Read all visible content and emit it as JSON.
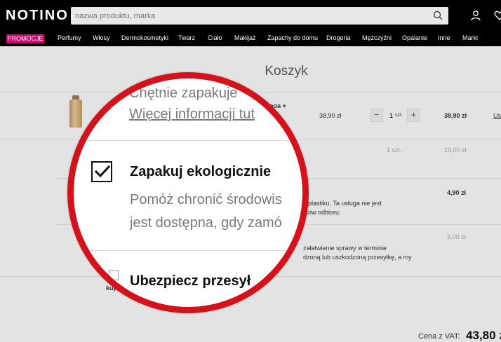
{
  "header": {
    "logo": "NOTINO",
    "search_placeholder": "nazwa produktu, marka",
    "icons": [
      "search-icon",
      "user-icon",
      "heart-icon"
    ]
  },
  "nav": {
    "promo": "PROMOCJE",
    "items": [
      "Perfumy",
      "Włosy",
      "Dermokosmetyki",
      "Twarz",
      "Ciało",
      "Makijaż",
      "Zapachy do domu",
      "Drogeria",
      "Mężczyźni",
      "Opalanie",
      "Inne",
      "Marki"
    ]
  },
  "cart": {
    "title": "Koszyk",
    "product": {
      "name_fragment": "noa +",
      "unit_price": "38,90 zł",
      "qty": "1",
      "qty_unit": "szt.",
      "total": "38,90 zł",
      "remove_fragment": "Us"
    },
    "row2": {
      "qty": "1 szt.",
      "price": "19,00 zł"
    },
    "eco": {
      "price": "4,90 zł",
      "desc_line1": "z plastiku. Ta usługa nie jest",
      "desc_line2": "stów odbioru."
    },
    "insurance": {
      "price": "3,00 zł",
      "desc_line1": "załatwienie sprawy w terminie",
      "desc_line2": "dzoną lub uszkodzoną przesyłkę, a my"
    },
    "coupon": {
      "label": "kupon",
      "button": "OK"
    },
    "total": {
      "label": "Cena z VAT:",
      "value": "43,80 z"
    }
  },
  "magnifier": {
    "line1": "Chętnie zapakuje",
    "link": "Więcej informacji tut",
    "eco_title": "Zapakuj ekologicznie",
    "eco_desc1": "Pomóż chronić środowis",
    "eco_desc2": "jest dostępna, gdy zamó",
    "ins_title": "Ubezpiecz przesył",
    "eco_checked": true
  },
  "colors": {
    "promo": "#d8006b",
    "ring": "#d3121b",
    "header": "#000000"
  }
}
